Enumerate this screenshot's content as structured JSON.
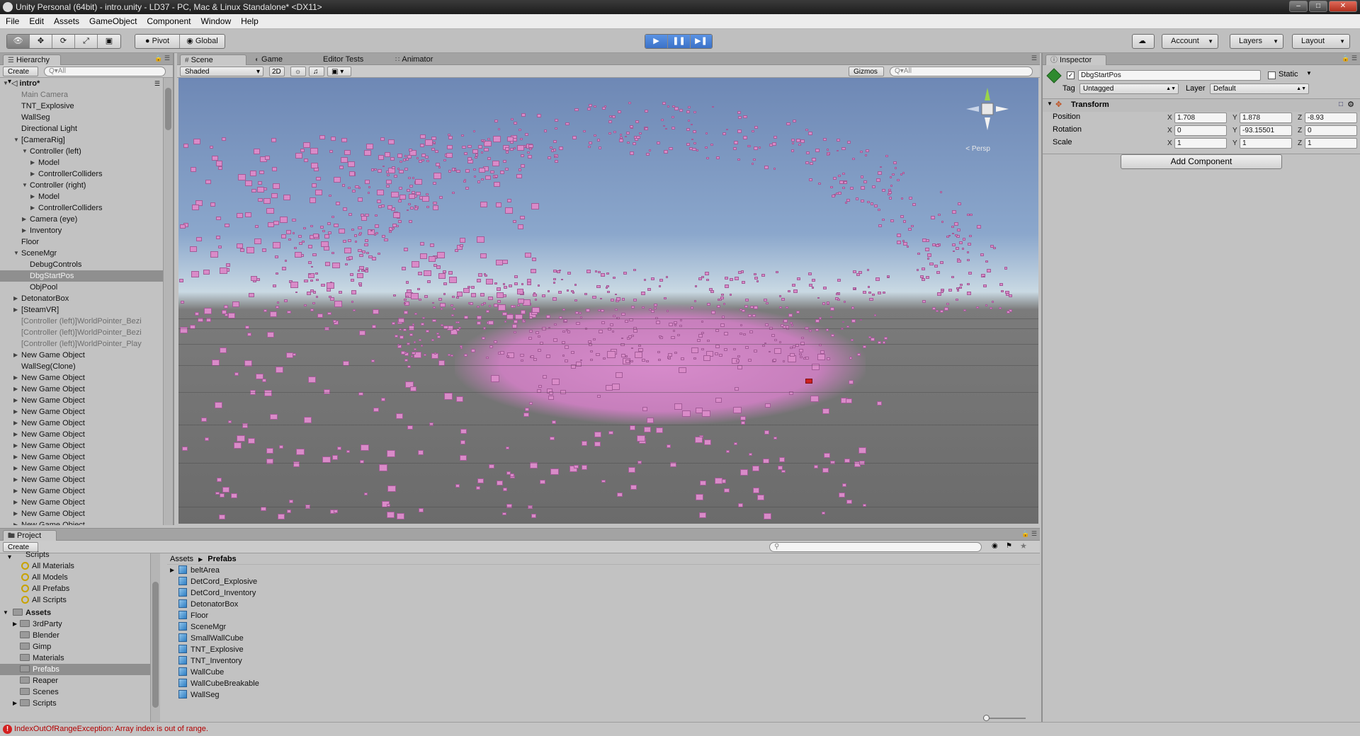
{
  "window": {
    "title": "Unity Personal (64bit) - intro.unity - LD37 - PC, Mac & Linux Standalone* <DX11>"
  },
  "menu": [
    "File",
    "Edit",
    "Assets",
    "GameObject",
    "Component",
    "Window",
    "Help"
  ],
  "toolbar": {
    "pivot_label": "Pivot",
    "global_label": "Global",
    "account_label": "Account",
    "layers_label": "Layers",
    "layout_label": "Layout"
  },
  "hierarchy": {
    "tab": "Hierarchy",
    "create": "Create",
    "search_placeholder": "Q▾All",
    "scene_name": "intro*",
    "items": [
      {
        "label": "Main Camera",
        "depth": 1,
        "faded": true
      },
      {
        "label": "TNT_Explosive",
        "depth": 1
      },
      {
        "label": "WallSeg",
        "depth": 1
      },
      {
        "label": "Directional Light",
        "depth": 1
      },
      {
        "label": "[CameraRig]",
        "depth": 1,
        "arrow": "open"
      },
      {
        "label": "Controller (left)",
        "depth": 2,
        "arrow": "open"
      },
      {
        "label": "Model",
        "depth": 3,
        "arrow": "closed"
      },
      {
        "label": "ControllerColliders",
        "depth": 3,
        "arrow": "closed"
      },
      {
        "label": "Controller (right)",
        "depth": 2,
        "arrow": "open"
      },
      {
        "label": "Model",
        "depth": 3,
        "arrow": "closed"
      },
      {
        "label": "ControllerColliders",
        "depth": 3,
        "arrow": "closed"
      },
      {
        "label": "Camera (eye)",
        "depth": 2,
        "arrow": "closed"
      },
      {
        "label": "Inventory",
        "depth": 2,
        "arrow": "closed"
      },
      {
        "label": "Floor",
        "depth": 1
      },
      {
        "label": "SceneMgr",
        "depth": 1,
        "arrow": "open"
      },
      {
        "label": "DebugControls",
        "depth": 2
      },
      {
        "label": "DbgStartPos",
        "depth": 2,
        "selected": true
      },
      {
        "label": "ObjPool",
        "depth": 2
      },
      {
        "label": "DetonatorBox",
        "depth": 1,
        "arrow": "closed"
      },
      {
        "label": "[SteamVR]",
        "depth": 1,
        "arrow": "closed"
      },
      {
        "label": "[Controller (left)]WorldPointer_Bezi",
        "depth": 1,
        "faded": true
      },
      {
        "label": "[Controller (left)]WorldPointer_Bezi",
        "depth": 1,
        "faded": true
      },
      {
        "label": "[Controller (left)]WorldPointer_Play",
        "depth": 1,
        "faded": true
      },
      {
        "label": "New Game Object",
        "depth": 1,
        "arrow": "closed"
      },
      {
        "label": "WallSeg(Clone)",
        "depth": 1
      },
      {
        "label": "New Game Object",
        "depth": 1,
        "arrow": "closed"
      },
      {
        "label": "New Game Object",
        "depth": 1,
        "arrow": "closed"
      },
      {
        "label": "New Game Object",
        "depth": 1,
        "arrow": "closed"
      },
      {
        "label": "New Game Object",
        "depth": 1,
        "arrow": "closed"
      },
      {
        "label": "New Game Object",
        "depth": 1,
        "arrow": "closed"
      },
      {
        "label": "New Game Object",
        "depth": 1,
        "arrow": "closed"
      },
      {
        "label": "New Game Object",
        "depth": 1,
        "arrow": "closed"
      },
      {
        "label": "New Game Object",
        "depth": 1,
        "arrow": "closed"
      },
      {
        "label": "New Game Object",
        "depth": 1,
        "arrow": "closed"
      },
      {
        "label": "New Game Object",
        "depth": 1,
        "arrow": "closed"
      },
      {
        "label": "New Game Object",
        "depth": 1,
        "arrow": "closed"
      },
      {
        "label": "New Game Object",
        "depth": 1,
        "arrow": "closed"
      },
      {
        "label": "New Game Object",
        "depth": 1,
        "arrow": "closed"
      },
      {
        "label": "New Game Object",
        "depth": 1,
        "arrow": "closed"
      }
    ]
  },
  "scene": {
    "tabs": [
      "Scene",
      "Game",
      "Editor Tests",
      "Animator"
    ],
    "shading": "Shaded",
    "mode_2d": "2D",
    "gizmos": "Gizmos",
    "search_placeholder": "Q▾All",
    "persp_label": "< Persp",
    "cube_color": "#d98bc8"
  },
  "inspector": {
    "tab": "Inspector",
    "object_name": "DbgStartPos",
    "static_label": "Static",
    "tag_label": "Tag",
    "tag_value": "Untagged",
    "layer_label": "Layer",
    "layer_value": "Default",
    "component": "Transform",
    "position_label": "Position",
    "rotation_label": "Rotation",
    "scale_label": "Scale",
    "position": {
      "x": "1.708",
      "y": "1.878",
      "z": "-8.93"
    },
    "rotation": {
      "x": "0",
      "y": "-93.15501",
      "z": "0"
    },
    "scale": {
      "x": "1",
      "y": "1",
      "z": "1"
    },
    "axis_x": "X",
    "axis_y": "Y",
    "axis_z": "Z",
    "add_component": "Add Component"
  },
  "project": {
    "tab": "Project",
    "create": "Create",
    "breadcrumb_root": "Assets",
    "breadcrumb_current": "Prefabs",
    "tree_top": "Scripts",
    "favorites": [
      "All Materials",
      "All Models",
      "All Prefabs",
      "All Scripts"
    ],
    "assets_label": "Assets",
    "folders": [
      {
        "label": "3rdParty",
        "arrow": true
      },
      {
        "label": "Blender"
      },
      {
        "label": "Gimp"
      },
      {
        "label": "Materials"
      },
      {
        "label": "Prefabs",
        "selected": true
      },
      {
        "label": "Reaper"
      },
      {
        "label": "Scenes"
      },
      {
        "label": "Scripts",
        "arrow": true
      }
    ],
    "prefabs": [
      "beltArea",
      "DetCord_Explosive",
      "DetCord_Inventory",
      "DetonatorBox",
      "Floor",
      "SceneMgr",
      "SmallWallCube",
      "TNT_Explosive",
      "TNT_Inventory",
      "WallCube",
      "WallCubeBreakable",
      "WallSeg"
    ]
  },
  "status": {
    "error": "IndexOutOfRangeException: Array index is out of range."
  }
}
